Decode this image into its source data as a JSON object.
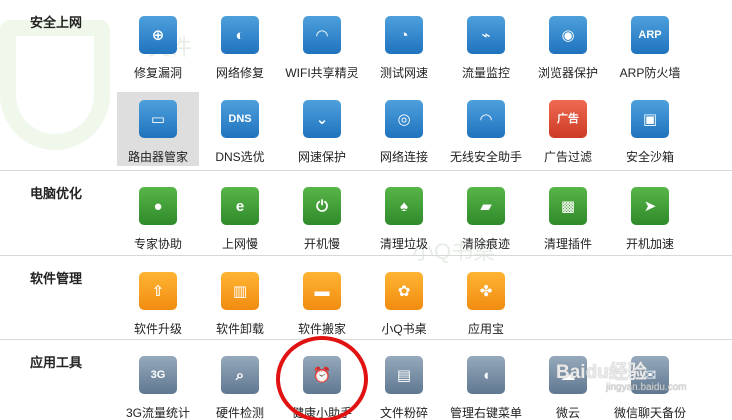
{
  "sections": [
    {
      "title": "安全上网",
      "items": [
        {
          "label": "修复漏洞",
          "icon": "shield-repair-icon",
          "glyph": "⊕",
          "color": "blue"
        },
        {
          "label": "网络修复",
          "icon": "globe-repair-icon",
          "glyph": "◐",
          "color": "blue"
        },
        {
          "label": "WIFI共享精灵",
          "icon": "wifi-icon",
          "glyph": "◠",
          "color": "blue"
        },
        {
          "label": "测试网速",
          "icon": "speedometer-icon",
          "glyph": "◔",
          "color": "blue"
        },
        {
          "label": "流量监控",
          "icon": "traffic-chart-icon",
          "glyph": "⌁",
          "color": "blue"
        },
        {
          "label": "浏览器保护",
          "icon": "browser-shield-icon",
          "glyph": "◉",
          "color": "blue"
        },
        {
          "label": "ARP防火墙",
          "icon": "arp-firewall-icon",
          "glyph": "ARP",
          "color": "blue"
        },
        {
          "label": "路由器管家",
          "icon": "router-icon",
          "glyph": "▭",
          "color": "blue",
          "selected": true
        },
        {
          "label": "DNS选优",
          "icon": "dns-icon",
          "glyph": "DNS",
          "color": "blue"
        },
        {
          "label": "网速保护",
          "icon": "speed-shield-icon",
          "glyph": "⌄",
          "color": "blue"
        },
        {
          "label": "网络连接",
          "icon": "network-connect-icon",
          "glyph": "◎",
          "color": "blue"
        },
        {
          "label": "无线安全助手",
          "icon": "wireless-security-icon",
          "glyph": "◠",
          "color": "blue"
        },
        {
          "label": "广告过滤",
          "icon": "ad-filter-icon",
          "glyph": "广告",
          "color": "red"
        },
        {
          "label": "安全沙箱",
          "icon": "sandbox-icon",
          "glyph": "▣",
          "color": "blue"
        }
      ]
    },
    {
      "title": "电脑优化",
      "items": [
        {
          "label": "专家协助",
          "icon": "expert-icon",
          "glyph": "●",
          "color": "green"
        },
        {
          "label": "上网慢",
          "icon": "slow-internet-icon",
          "glyph": "e",
          "color": "green"
        },
        {
          "label": "开机慢",
          "icon": "slow-boot-icon",
          "glyph": "⏻",
          "color": "green"
        },
        {
          "label": "清理垃圾",
          "icon": "broom-icon",
          "glyph": "♠",
          "color": "green"
        },
        {
          "label": "清除痕迹",
          "icon": "eraser-icon",
          "glyph": "▰",
          "color": "green"
        },
        {
          "label": "清理插件",
          "icon": "puzzle-icon",
          "glyph": "▩",
          "color": "green"
        },
        {
          "label": "开机加速",
          "icon": "rocket-icon",
          "glyph": "➤",
          "color": "green"
        }
      ]
    },
    {
      "title": "软件管理",
      "items": [
        {
          "label": "软件升级",
          "icon": "upgrade-icon",
          "glyph": "⇧",
          "color": "orange"
        },
        {
          "label": "软件卸载",
          "icon": "trash-icon",
          "glyph": "▥",
          "color": "orange"
        },
        {
          "label": "软件搬家",
          "icon": "truck-icon",
          "glyph": "▬",
          "color": "orange"
        },
        {
          "label": "小Q书桌",
          "icon": "desk-icon",
          "glyph": "✿",
          "color": "orange"
        },
        {
          "label": "应用宝",
          "icon": "app-store-icon",
          "glyph": "✤",
          "color": "orange"
        }
      ]
    },
    {
      "title": "应用工具",
      "items": [
        {
          "label": "3G流量统计",
          "icon": "3g-icon",
          "glyph": "3G",
          "color": "gray"
        },
        {
          "label": "硬件检测",
          "icon": "hardware-check-icon",
          "glyph": "⌕",
          "color": "gray"
        },
        {
          "label": "健康小助手",
          "icon": "alarm-clock-icon",
          "glyph": "⏰",
          "color": "gray"
        },
        {
          "label": "文件粉碎",
          "icon": "shredder-icon",
          "glyph": "▤",
          "color": "gray"
        },
        {
          "label": "管理右键菜单",
          "icon": "mouse-icon",
          "glyph": "◖",
          "color": "gray"
        },
        {
          "label": "微云",
          "icon": "cloud-icon",
          "glyph": "☁",
          "color": "gray"
        },
        {
          "label": "微信聊天备份",
          "icon": "chat-backup-icon",
          "glyph": "✉",
          "color": "gray"
        }
      ]
    }
  ],
  "watermark": {
    "main": "Baidu经验",
    "sub": "jingyan.baidu.com"
  }
}
